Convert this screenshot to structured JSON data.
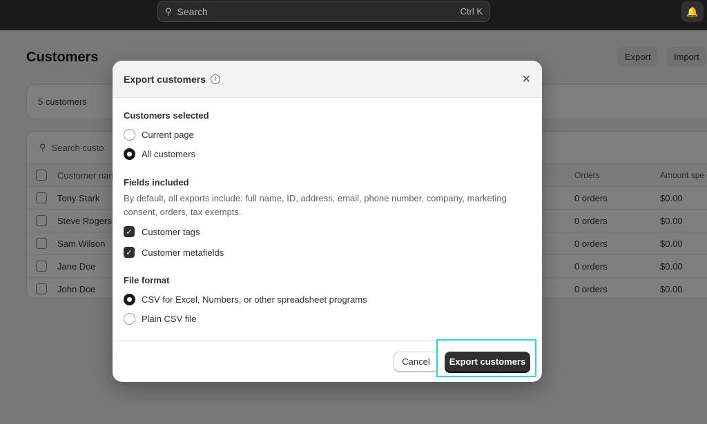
{
  "topbar": {
    "search_placeholder": "Search",
    "shortcut": "Ctrl K"
  },
  "page": {
    "title": "Customers",
    "export_label": "Export",
    "import_label": "Import",
    "count": "5 customers",
    "table_search": "Search custo"
  },
  "table": {
    "headers": [
      "Customer nam",
      "Orders",
      "Amount spe"
    ],
    "rows": [
      {
        "name": "Tony Stark",
        "orders": "0 orders",
        "amount": "$0.00"
      },
      {
        "name": "Steve Rogers",
        "orders": "0 orders",
        "amount": "$0.00"
      },
      {
        "name": "Sam Wilson",
        "orders": "0 orders",
        "amount": "$0.00"
      },
      {
        "name": "Jane Doe",
        "orders": "0 orders",
        "amount": "$0.00"
      },
      {
        "name": "John Doe",
        "orders": "0 orders",
        "amount": "$0.00"
      }
    ]
  },
  "modal": {
    "title": "Export customers",
    "selected_heading": "Customers selected",
    "opt_current": "Current page",
    "opt_all": "All customers",
    "selected_value": "All customers",
    "fields_heading": "Fields included",
    "fields_desc": "By default, all exports include: full name, ID, address, email, phone number, company, marketing consent, orders, tax exempts.",
    "chk_tags": "Customer tags",
    "chk_meta": "Customer metafields",
    "format_heading": "File format",
    "fmt_excel": "CSV for Excel, Numbers, or other spreadsheet programs",
    "fmt_plain": "Plain CSV file",
    "format_value": "CSV for Excel, Numbers, or other spreadsheet programs",
    "cancel": "Cancel",
    "submit": "Export customers"
  },
  "colors": {
    "highlight": "#22e0c4",
    "primary": "#303030"
  }
}
